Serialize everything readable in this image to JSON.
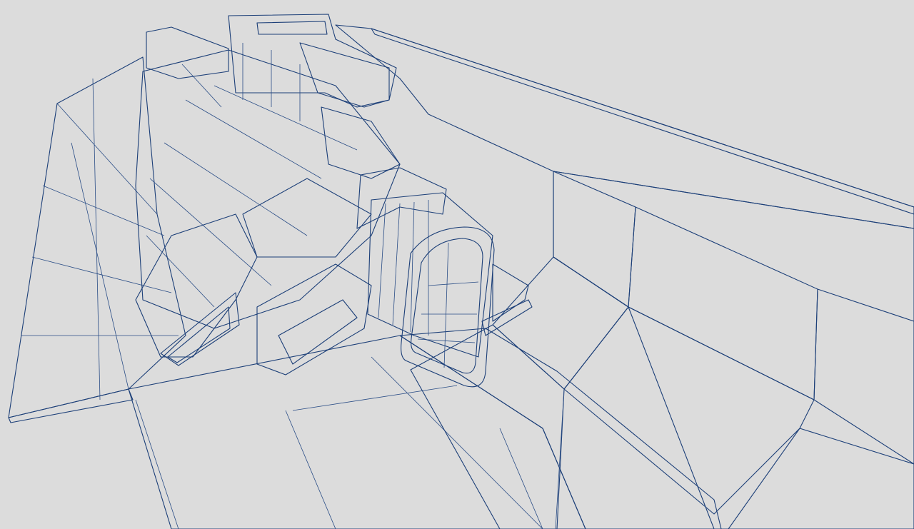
{
  "render": {
    "subject": "spaceship-wireframe-render",
    "background_color": "#dcdcdc",
    "wireframe_color": "#1c3f78",
    "surface_light": "#e9f0f8",
    "surface_mid": "#bcd0e6",
    "surface_shadow": "#8fb0d2"
  }
}
